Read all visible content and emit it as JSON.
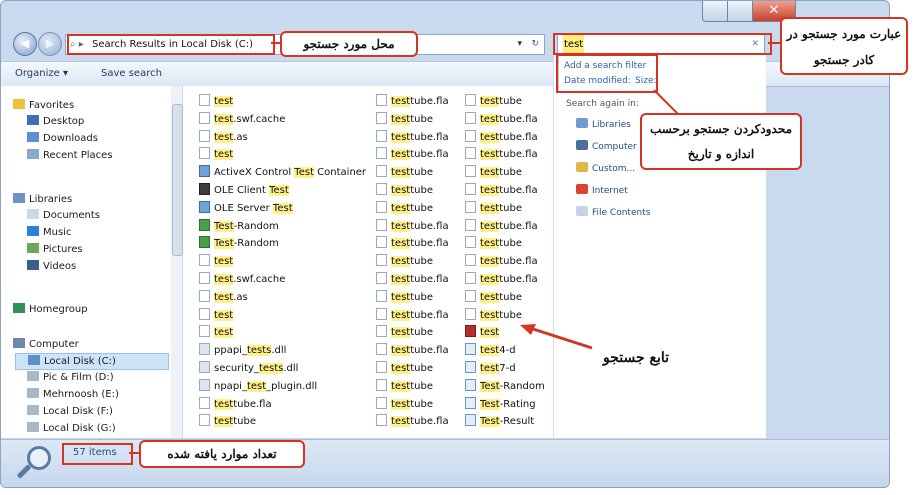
{
  "window": {
    "close_glyph": "✕"
  },
  "address_bar": {
    "path": "Search Results in Local Disk (C:)",
    "dropdown_glyph": "▾",
    "refresh_glyph": "↻"
  },
  "search": {
    "value": "test",
    "clear_glyph": "✕"
  },
  "toolbar": {
    "organize": "Organize ▾",
    "save_search": "Save search"
  },
  "nav": {
    "favorites": "Favorites",
    "favorites_items": [
      "Desktop",
      "Downloads",
      "Recent Places"
    ],
    "libraries": "Libraries",
    "libraries_items": [
      "Documents",
      "Music",
      "Pictures",
      "Videos"
    ],
    "homegroup": "Homegroup",
    "computer": "Computer",
    "computer_items": [
      "Local Disk (C:)",
      "Pic & Film (D:)",
      "Mehrnoosh (E:)",
      "Local Disk (F:)",
      "Local Disk (G:)"
    ]
  },
  "results": {
    "col1": [
      [
        "",
        "test",
        "",
        "doc"
      ],
      [
        "",
        "test",
        ".swf.cache",
        "doc"
      ],
      [
        "",
        "test",
        ".as",
        "doc"
      ],
      [
        "",
        "test",
        "",
        "doc"
      ],
      [
        "ActiveX Control ",
        "Test",
        " Container",
        "img"
      ],
      [
        "OLE Client ",
        "Test",
        "",
        "ole"
      ],
      [
        "OLE Server ",
        "Test",
        "",
        "img"
      ],
      [
        "",
        "Test",
        "-Random",
        "xls"
      ],
      [
        "",
        "Test",
        "-Random",
        "xls"
      ],
      [
        "",
        "test",
        "",
        "doc"
      ],
      [
        "",
        "test",
        ".swf.cache",
        "doc"
      ],
      [
        "",
        "test",
        ".as",
        "doc"
      ],
      [
        "",
        "test",
        "",
        "doc"
      ],
      [
        "",
        "test",
        "",
        "doc"
      ],
      [
        "ppapi_",
        "tests",
        ".dll",
        "dll"
      ],
      [
        "security_",
        "tests",
        ".dll",
        "dll"
      ],
      [
        "npapi_",
        "test",
        "_plugin.dll",
        "dll"
      ],
      [
        "",
        "test",
        "tube.fla",
        "doc"
      ],
      [
        "",
        "test",
        "tube",
        "doc"
      ]
    ],
    "col2": [
      [
        "",
        "test",
        "tube.fla",
        "doc"
      ],
      [
        "",
        "test",
        "tube",
        "doc"
      ],
      [
        "",
        "test",
        "tube.fla",
        "doc"
      ],
      [
        "",
        "test",
        "tube.fla",
        "doc"
      ],
      [
        "",
        "test",
        "tube",
        "doc"
      ],
      [
        "",
        "test",
        "tube",
        "doc"
      ],
      [
        "",
        "test",
        "tube",
        "doc"
      ],
      [
        "",
        "test",
        "tube.fla",
        "doc"
      ],
      [
        "",
        "test",
        "tube.fla",
        "doc"
      ],
      [
        "",
        "test",
        "tube",
        "doc"
      ],
      [
        "",
        "test",
        "tube.fla",
        "doc"
      ],
      [
        "",
        "test",
        "tube",
        "doc"
      ],
      [
        "",
        "test",
        "tube.fla",
        "doc"
      ],
      [
        "",
        "test",
        "tube",
        "doc"
      ],
      [
        "",
        "test",
        "tube.fla",
        "doc"
      ],
      [
        "",
        "test",
        "tube",
        "doc"
      ],
      [
        "",
        "test",
        "tube",
        "doc"
      ],
      [
        "",
        "test",
        "tube",
        "doc"
      ],
      [
        "",
        "test",
        "tube.fla",
        "doc"
      ]
    ],
    "col3": [
      [
        "",
        "test",
        "tube",
        "doc"
      ],
      [
        "",
        "test",
        "tube.fla",
        "doc"
      ],
      [
        "",
        "test",
        "tube.fla",
        "doc"
      ],
      [
        "",
        "test",
        "tube.fla",
        "doc"
      ],
      [
        "",
        "test",
        "tube",
        "doc"
      ],
      [
        "",
        "test",
        "tube.fla",
        "doc"
      ],
      [
        "",
        "test",
        "tube",
        "doc"
      ],
      [
        "",
        "test",
        "tube.fla",
        "doc"
      ],
      [
        "",
        "test",
        "tube",
        "doc"
      ],
      [
        "",
        "test",
        "tube.fla",
        "doc"
      ],
      [
        "",
        "test",
        "tube.fla",
        "doc"
      ],
      [
        "",
        "test",
        "tube",
        "doc"
      ],
      [
        "",
        "test",
        "tube",
        "doc"
      ],
      [
        "",
        "test",
        "",
        "fla"
      ],
      [
        "",
        "test",
        "4-d",
        "rtf"
      ],
      [
        "",
        "test",
        "7-d",
        "rtf"
      ],
      [
        "",
        "Test",
        "-Random",
        "rtf"
      ],
      [
        "",
        "Test",
        "-Rating",
        "rtf"
      ],
      [
        "",
        "Test",
        "-Result",
        "rtf"
      ]
    ]
  },
  "side_pane": {
    "add_filter": "Add a search filter",
    "date_modified": "Date modified:",
    "size": "Size:",
    "search_again_in": "Search again in:",
    "items": [
      "Libraries",
      "Computer",
      "Custom...",
      "Internet",
      "File Contents"
    ]
  },
  "status": {
    "count": "57 items"
  },
  "annotations": {
    "location": "محل مورد جستجو",
    "search_term": "عبارت مورد جستجو در کادر جستجو",
    "filter": "محدودکردن جستجو برحسب اندازه و تاریخ",
    "function": "تابع جستجو",
    "count": "تعداد موارد یافته شده"
  },
  "colors": {
    "accent_red": "#d43424",
    "highlight": "#fff18a"
  }
}
